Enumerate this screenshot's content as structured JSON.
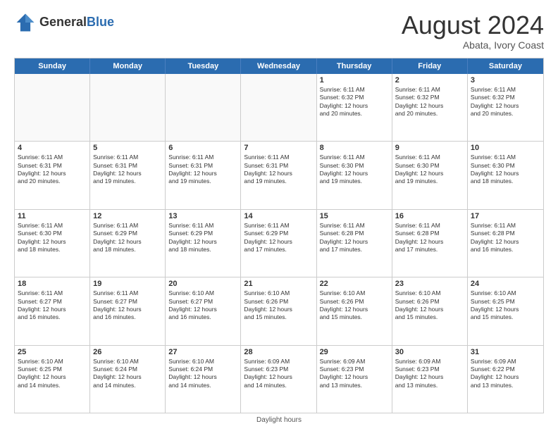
{
  "header": {
    "logo_general": "General",
    "logo_blue": "Blue",
    "month_year": "August 2024",
    "location": "Abata, Ivory Coast"
  },
  "weekdays": [
    "Sunday",
    "Monday",
    "Tuesday",
    "Wednesday",
    "Thursday",
    "Friday",
    "Saturday"
  ],
  "footer": {
    "daylight_hours": "Daylight hours"
  },
  "rows": [
    [
      {
        "day": "",
        "text": "",
        "empty": true
      },
      {
        "day": "",
        "text": "",
        "empty": true
      },
      {
        "day": "",
        "text": "",
        "empty": true
      },
      {
        "day": "",
        "text": "",
        "empty": true
      },
      {
        "day": "1",
        "text": "Sunrise: 6:11 AM\nSunset: 6:32 PM\nDaylight: 12 hours\nand 20 minutes.",
        "empty": false
      },
      {
        "day": "2",
        "text": "Sunrise: 6:11 AM\nSunset: 6:32 PM\nDaylight: 12 hours\nand 20 minutes.",
        "empty": false
      },
      {
        "day": "3",
        "text": "Sunrise: 6:11 AM\nSunset: 6:32 PM\nDaylight: 12 hours\nand 20 minutes.",
        "empty": false
      }
    ],
    [
      {
        "day": "4",
        "text": "Sunrise: 6:11 AM\nSunset: 6:31 PM\nDaylight: 12 hours\nand 20 minutes.",
        "empty": false
      },
      {
        "day": "5",
        "text": "Sunrise: 6:11 AM\nSunset: 6:31 PM\nDaylight: 12 hours\nand 19 minutes.",
        "empty": false
      },
      {
        "day": "6",
        "text": "Sunrise: 6:11 AM\nSunset: 6:31 PM\nDaylight: 12 hours\nand 19 minutes.",
        "empty": false
      },
      {
        "day": "7",
        "text": "Sunrise: 6:11 AM\nSunset: 6:31 PM\nDaylight: 12 hours\nand 19 minutes.",
        "empty": false
      },
      {
        "day": "8",
        "text": "Sunrise: 6:11 AM\nSunset: 6:30 PM\nDaylight: 12 hours\nand 19 minutes.",
        "empty": false
      },
      {
        "day": "9",
        "text": "Sunrise: 6:11 AM\nSunset: 6:30 PM\nDaylight: 12 hours\nand 19 minutes.",
        "empty": false
      },
      {
        "day": "10",
        "text": "Sunrise: 6:11 AM\nSunset: 6:30 PM\nDaylight: 12 hours\nand 18 minutes.",
        "empty": false
      }
    ],
    [
      {
        "day": "11",
        "text": "Sunrise: 6:11 AM\nSunset: 6:30 PM\nDaylight: 12 hours\nand 18 minutes.",
        "empty": false
      },
      {
        "day": "12",
        "text": "Sunrise: 6:11 AM\nSunset: 6:29 PM\nDaylight: 12 hours\nand 18 minutes.",
        "empty": false
      },
      {
        "day": "13",
        "text": "Sunrise: 6:11 AM\nSunset: 6:29 PM\nDaylight: 12 hours\nand 18 minutes.",
        "empty": false
      },
      {
        "day": "14",
        "text": "Sunrise: 6:11 AM\nSunset: 6:29 PM\nDaylight: 12 hours\nand 17 minutes.",
        "empty": false
      },
      {
        "day": "15",
        "text": "Sunrise: 6:11 AM\nSunset: 6:28 PM\nDaylight: 12 hours\nand 17 minutes.",
        "empty": false
      },
      {
        "day": "16",
        "text": "Sunrise: 6:11 AM\nSunset: 6:28 PM\nDaylight: 12 hours\nand 17 minutes.",
        "empty": false
      },
      {
        "day": "17",
        "text": "Sunrise: 6:11 AM\nSunset: 6:28 PM\nDaylight: 12 hours\nand 16 minutes.",
        "empty": false
      }
    ],
    [
      {
        "day": "18",
        "text": "Sunrise: 6:11 AM\nSunset: 6:27 PM\nDaylight: 12 hours\nand 16 minutes.",
        "empty": false
      },
      {
        "day": "19",
        "text": "Sunrise: 6:11 AM\nSunset: 6:27 PM\nDaylight: 12 hours\nand 16 minutes.",
        "empty": false
      },
      {
        "day": "20",
        "text": "Sunrise: 6:10 AM\nSunset: 6:27 PM\nDaylight: 12 hours\nand 16 minutes.",
        "empty": false
      },
      {
        "day": "21",
        "text": "Sunrise: 6:10 AM\nSunset: 6:26 PM\nDaylight: 12 hours\nand 15 minutes.",
        "empty": false
      },
      {
        "day": "22",
        "text": "Sunrise: 6:10 AM\nSunset: 6:26 PM\nDaylight: 12 hours\nand 15 minutes.",
        "empty": false
      },
      {
        "day": "23",
        "text": "Sunrise: 6:10 AM\nSunset: 6:26 PM\nDaylight: 12 hours\nand 15 minutes.",
        "empty": false
      },
      {
        "day": "24",
        "text": "Sunrise: 6:10 AM\nSunset: 6:25 PM\nDaylight: 12 hours\nand 15 minutes.",
        "empty": false
      }
    ],
    [
      {
        "day": "25",
        "text": "Sunrise: 6:10 AM\nSunset: 6:25 PM\nDaylight: 12 hours\nand 14 minutes.",
        "empty": false
      },
      {
        "day": "26",
        "text": "Sunrise: 6:10 AM\nSunset: 6:24 PM\nDaylight: 12 hours\nand 14 minutes.",
        "empty": false
      },
      {
        "day": "27",
        "text": "Sunrise: 6:10 AM\nSunset: 6:24 PM\nDaylight: 12 hours\nand 14 minutes.",
        "empty": false
      },
      {
        "day": "28",
        "text": "Sunrise: 6:09 AM\nSunset: 6:23 PM\nDaylight: 12 hours\nand 14 minutes.",
        "empty": false
      },
      {
        "day": "29",
        "text": "Sunrise: 6:09 AM\nSunset: 6:23 PM\nDaylight: 12 hours\nand 13 minutes.",
        "empty": false
      },
      {
        "day": "30",
        "text": "Sunrise: 6:09 AM\nSunset: 6:23 PM\nDaylight: 12 hours\nand 13 minutes.",
        "empty": false
      },
      {
        "day": "31",
        "text": "Sunrise: 6:09 AM\nSunset: 6:22 PM\nDaylight: 12 hours\nand 13 minutes.",
        "empty": false
      }
    ]
  ]
}
